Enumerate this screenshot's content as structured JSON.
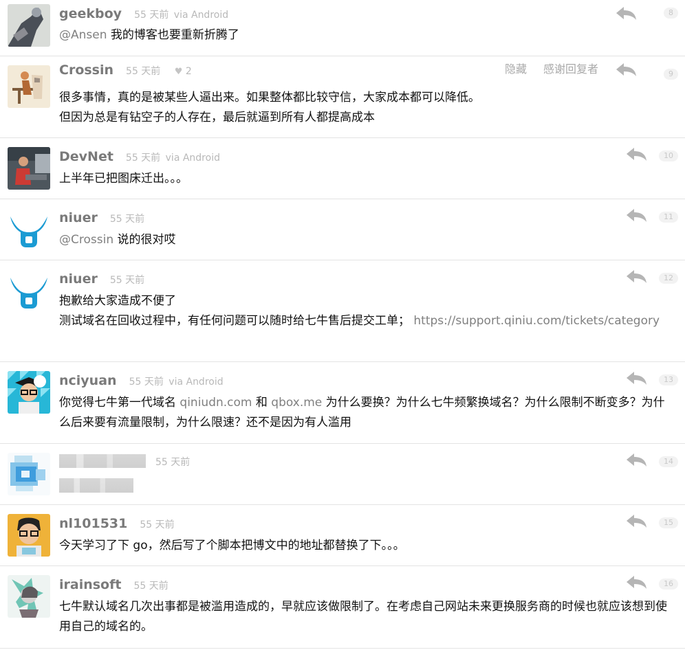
{
  "replies": [
    {
      "author": "geekboy",
      "time": "55 天前",
      "via": "via Android",
      "floor": "8",
      "content_mention": "@Ansen",
      "content_text": " 我的博客也要重新折腾了"
    },
    {
      "author": "Crossin",
      "time": "55 天前",
      "thanks_icon": "heart-icon",
      "thanks_count": "2",
      "hide_label": "隐藏",
      "thank_label": "感谢回复者",
      "floor": "9",
      "line1": "很多事情，真的是被某些人逼出来。如果整体都比较守信，大家成本都可以降低。",
      "line2": "但因为总是有钻空子的人存在，最后就逼到所有人都提高成本"
    },
    {
      "author": "DevNet",
      "time": "55 天前",
      "via": "via Android",
      "floor": "10",
      "content_text": "上半年已把图床迁出。。。"
    },
    {
      "author": "niuer",
      "time": "55 天前",
      "floor": "11",
      "content_mention": "@Crossin",
      "content_text": " 说的很对哎"
    },
    {
      "author": "niuer",
      "time": "55 天前",
      "floor": "12",
      "line1": "抱歉给大家造成不便了",
      "line2_text": "测试域名在回收过程中，有任何问题可以随时给七牛售后提交工单； ",
      "line2_link": "https://support.qiniu.com/tickets/category"
    },
    {
      "author": "nciyuan",
      "time": "55 天前",
      "via": "via Android",
      "floor": "13",
      "c1": "你觉得七牛第一代域名 ",
      "link1": "qiniudn.com",
      "c2": " 和 ",
      "link2": "qbox.me",
      "c3": " 为什么要换？为什么七牛频繁换域名？为什么限制不断变多？为什么后来要有流量限制，为什么限速？还不是因为有人滥用"
    },
    {
      "author": "",
      "time": "55 天前",
      "floor": "14",
      "content_text": ""
    },
    {
      "author": "nl101531",
      "time": "55 天前",
      "floor": "15",
      "content_text": "今天学习了下 go，然后写了个脚本把博文中的地址都替换了下。。。"
    },
    {
      "author": "irainsoft",
      "time": "55 天前",
      "floor": "16",
      "content_text": "七牛默认域名几次出事都是被滥用造成的，早就应该做限制了。在考虑自己网站未来更换服务商的时候也就应该想到使用自己的域名的。"
    }
  ],
  "icons": {
    "reply": "reply-arrow-icon",
    "thanks": "heart-icon"
  },
  "colors": {
    "author": "#7a7a7a",
    "meta": "#b8b8b8",
    "link": "#808080",
    "floor_bg": "#f2f2f2",
    "divider": "#e3e3e3"
  }
}
